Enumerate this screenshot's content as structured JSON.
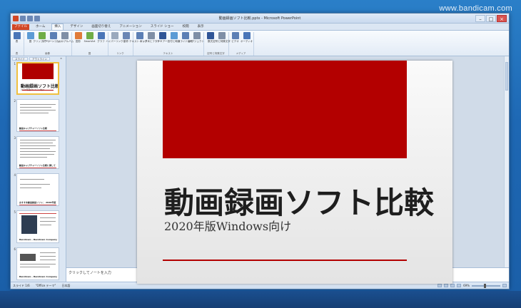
{
  "watermark": "www.bandicam.com",
  "window": {
    "title": "動画録画ソフト比較.pptx - Microsoft PowerPoint"
  },
  "ribbon_tabs": [
    {
      "label": "ファイル",
      "type": "file"
    },
    {
      "label": "ホーム",
      "type": ""
    },
    {
      "label": "挿入",
      "type": "active"
    },
    {
      "label": "デザイン",
      "type": ""
    },
    {
      "label": "画面切り替え",
      "type": ""
    },
    {
      "label": "アニメーション",
      "type": ""
    },
    {
      "label": "スライド ショー",
      "type": ""
    },
    {
      "label": "校閲",
      "type": ""
    },
    {
      "label": "表示",
      "type": ""
    }
  ],
  "ribbon_groups": [
    {
      "label": "表",
      "buttons": [
        {
          "label": "表",
          "color": "#4a76b8"
        }
      ]
    },
    {
      "label": "画像",
      "buttons": [
        {
          "label": "図",
          "color": "#5b9bd5"
        },
        {
          "label": "クリップアート",
          "color": "#70ad47"
        },
        {
          "label": "スクリーンショット",
          "color": "#5b7fb5"
        },
        {
          "label": "フォト アルバム",
          "color": "#7f8fa6"
        }
      ]
    },
    {
      "label": "図",
      "buttons": [
        {
          "label": "図形",
          "color": "#e07b39"
        },
        {
          "label": "SmartArt",
          "color": "#70ad47"
        },
        {
          "label": "グラフ",
          "color": "#4a76b8"
        }
      ]
    },
    {
      "label": "リンク",
      "buttons": [
        {
          "label": "ハイパーリンク",
          "color": "#9aa9bd"
        },
        {
          "label": "動作",
          "color": "#6b87b5"
        }
      ]
    },
    {
      "label": "テキスト",
      "buttons": [
        {
          "label": "テキスト ボックス",
          "color": "#5b7fb5"
        },
        {
          "label": "ヘッダーとフッター",
          "color": "#7f8fa6"
        },
        {
          "label": "ワードアート",
          "color": "#2f5597"
        },
        {
          "label": "日付と時刻",
          "color": "#5b9bd5"
        },
        {
          "label": "スライド番号",
          "color": "#5b7fb5"
        },
        {
          "label": "オブジェクト",
          "color": "#7f8fa6"
        }
      ]
    },
    {
      "label": "記号と特殊文字",
      "buttons": [
        {
          "label": "数式",
          "color": "#2f5597"
        },
        {
          "label": "記号と特殊文字",
          "color": "#7f8fa6"
        }
      ]
    },
    {
      "label": "メディア",
      "buttons": [
        {
          "label": "ビデオ",
          "color": "#5b7fb5"
        },
        {
          "label": "オーディオ",
          "color": "#4a76b8"
        }
      ]
    }
  ],
  "side_panel": {
    "tabs": [
      "スライド",
      "アウトライン"
    ],
    "close": "×",
    "slides": [
      {
        "num": "1",
        "caption": "動画録画ソフト比較",
        "sub": "2020年版Windows向け"
      },
      {
        "num": "2",
        "caption": "動画キャプチャーソフト比較"
      },
      {
        "num": "3",
        "caption": "動画キャプチャーソフト比較に関して"
      },
      {
        "num": "4",
        "caption": "おすすめ動画録画ソフト： 2020年版"
      },
      {
        "num": "5",
        "caption": "Bandicam - Bandicam Company"
      },
      {
        "num": "6",
        "caption": "Bandicam - Bandicam Company"
      }
    ]
  },
  "slide": {
    "title": "動画録画ソフト比較",
    "subtitle": "2020年版Windows向け",
    "accent_color": "#b30000"
  },
  "notes": {
    "placeholder": "クリックしてノートを入力"
  },
  "status": {
    "slide_info": "スライド 1/6",
    "theme": "\"Office テーマ\"",
    "language": "日本語",
    "zoom": "69%"
  }
}
